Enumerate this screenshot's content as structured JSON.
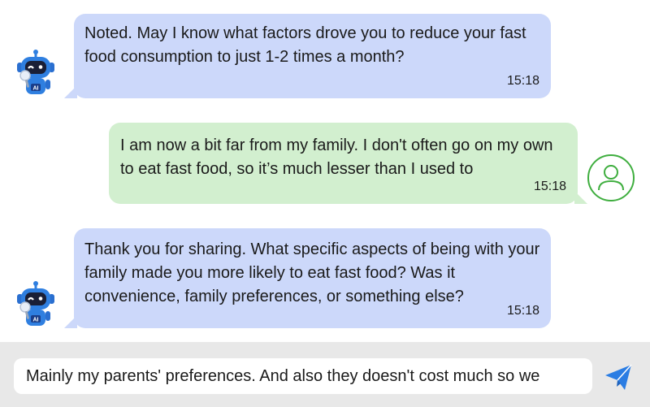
{
  "colors": {
    "bot_bubble": "#ccd8fa",
    "user_bubble": "#d2efcf",
    "user_avatar_stroke": "#3fae3f",
    "send_icon": "#2b7de3",
    "bot_avatar_body": "#2f7fe0",
    "input_bar_background": "#e8e8e8"
  },
  "messages": [
    {
      "sender": "bot",
      "avatar_icon": "ai-robot-icon",
      "avatar_badge": "AI",
      "text": "Noted. May I know what factors drove you to reduce your fast food consumption to just 1-2 times a month?",
      "time": "15:18"
    },
    {
      "sender": "user",
      "avatar_icon": "user-profile-icon",
      "text": "I am now a bit far from my family. I don't often go on my own to eat fast food, so it’s much lesser than I used to",
      "time": "15:18"
    },
    {
      "sender": "bot",
      "avatar_icon": "ai-robot-icon",
      "avatar_badge": "AI",
      "text": "Thank you for sharing. What specific aspects of being with your family made you more likely to eat fast food? Was it convenience, family preferences, or something else?",
      "time": "15:18"
    }
  ],
  "composer": {
    "value": "Mainly my parents' preferences. And also they doesn't cost much so we",
    "send_icon": "send-paper-plane-icon"
  }
}
